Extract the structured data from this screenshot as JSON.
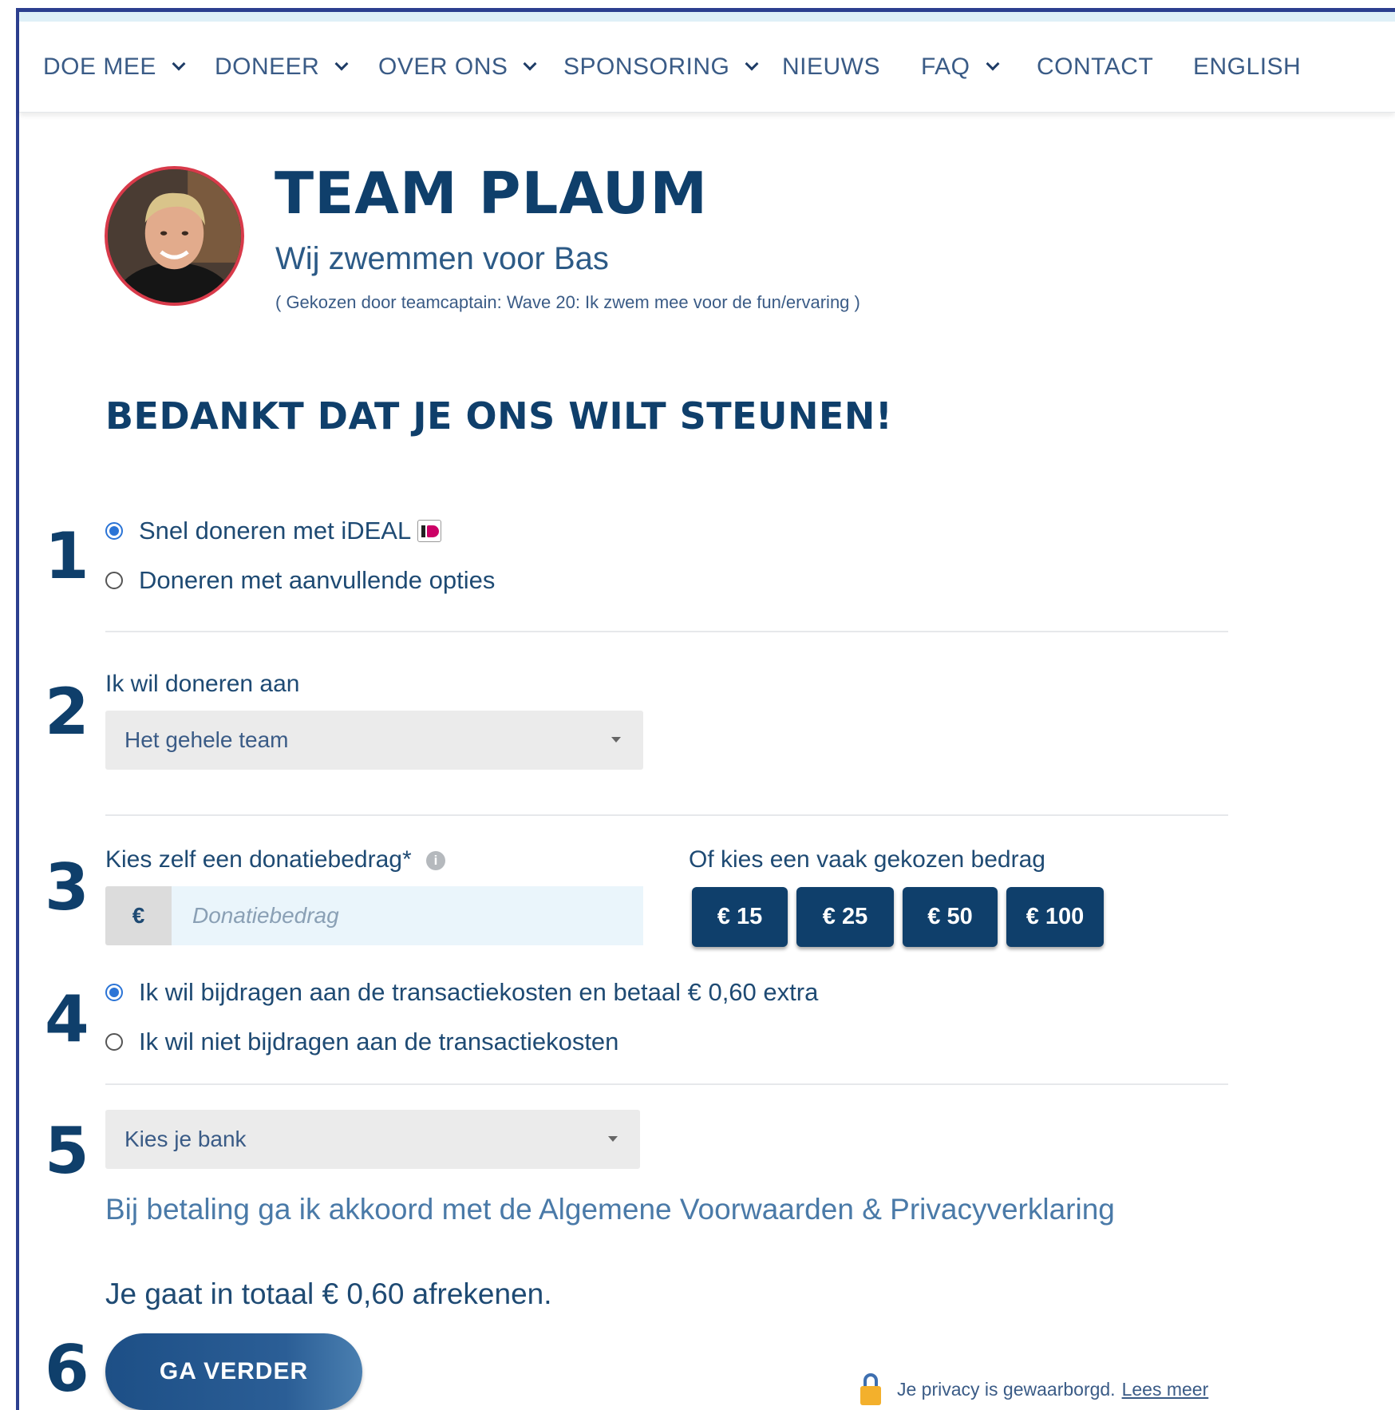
{
  "nav": {
    "items": [
      {
        "label": "DOE MEE",
        "dropdown": true
      },
      {
        "label": "DONEER",
        "dropdown": true
      },
      {
        "label": "OVER ONS",
        "dropdown": true
      },
      {
        "label": "SPONSORING",
        "dropdown": true
      },
      {
        "label": "NIEUWS",
        "dropdown": false
      },
      {
        "label": "FAQ",
        "dropdown": true
      },
      {
        "label": "CONTACT",
        "dropdown": false
      },
      {
        "label": "ENGLISH",
        "dropdown": false
      }
    ]
  },
  "team": {
    "title": "TEAM PLAUM",
    "subtitle": "Wij zwemmen voor Bas",
    "note": "( Gekozen door teamcaptain: Wave 20: Ik zwem mee voor de fun/ervaring )"
  },
  "thanks_heading": "BEDANKT DAT JE ONS WILT STEUNEN!",
  "steps": [
    "1",
    "2",
    "3",
    "4",
    "5",
    "6"
  ],
  "step1": {
    "options": [
      {
        "label": "Snel doneren met iDEAL",
        "selected": true,
        "icon": "ideal-logo-icon"
      },
      {
        "label": "Doneren met aanvullende opties",
        "selected": false
      }
    ]
  },
  "step2": {
    "label": "Ik wil doneren aan",
    "selected": "Het gehele team"
  },
  "step3": {
    "label": "Kies zelf een donatiebedrag*",
    "info_icon": "i",
    "currency": "€",
    "placeholder": "Donatiebedrag",
    "presets_label": "Of kies een vaak gekozen bedrag",
    "presets": [
      "€ 15",
      "€ 25",
      "€ 50",
      "€ 100"
    ]
  },
  "step4": {
    "options": [
      {
        "label": "Ik wil bijdragen aan de transactiekosten en betaal € 0,60 extra",
        "selected": true
      },
      {
        "label": "Ik wil niet bijdragen aan de transactiekosten",
        "selected": false
      }
    ]
  },
  "step5": {
    "bank_placeholder": "Kies je bank",
    "agreement": "Bij betaling ga ik akkoord met de Algemene Voorwaarden & Privacyverklaring",
    "total": "Je gaat in totaal € 0,60 afrekenen."
  },
  "step6": {
    "button": "GA VERDER",
    "privacy_text": "Je privacy is gewaarborgd.",
    "privacy_link": "Lees meer"
  },
  "colors": {
    "primary": "#0f3f6b",
    "accent_radio": "#2b74d6",
    "frame": "#2c3f8f",
    "avatar_border": "#d83a4a"
  }
}
